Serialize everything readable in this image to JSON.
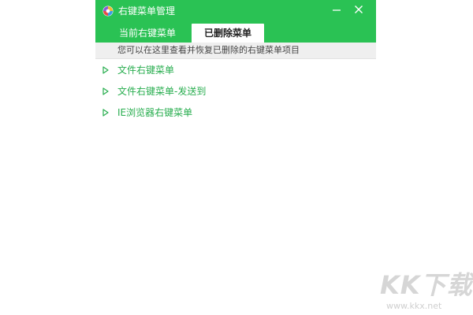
{
  "window": {
    "title": "右键菜单管理",
    "logo_icon": "app-logo-icon",
    "minimize_icon": "minimize-icon",
    "close_icon": "close-icon"
  },
  "tabs": [
    {
      "label": "当前右键菜单",
      "selected": false
    },
    {
      "label": "已删除菜单",
      "selected": true
    }
  ],
  "hint": "您可以在这里查看并恢复已删除的右键菜单项目",
  "deleted_menus": [
    {
      "label": "文件右键菜单",
      "icon": "expand-arrow-icon"
    },
    {
      "label": "文件右键菜单-发送到",
      "icon": "expand-arrow-icon"
    },
    {
      "label": "IE浏览器右键菜单",
      "icon": "expand-arrow-icon"
    }
  ],
  "watermark": {
    "logo": "KK下载",
    "url": "www.kkx.net"
  },
  "colors": {
    "titlebar": "#2ac254",
    "item_text": "#27ad4e",
    "hint_bg": "#efefef"
  }
}
